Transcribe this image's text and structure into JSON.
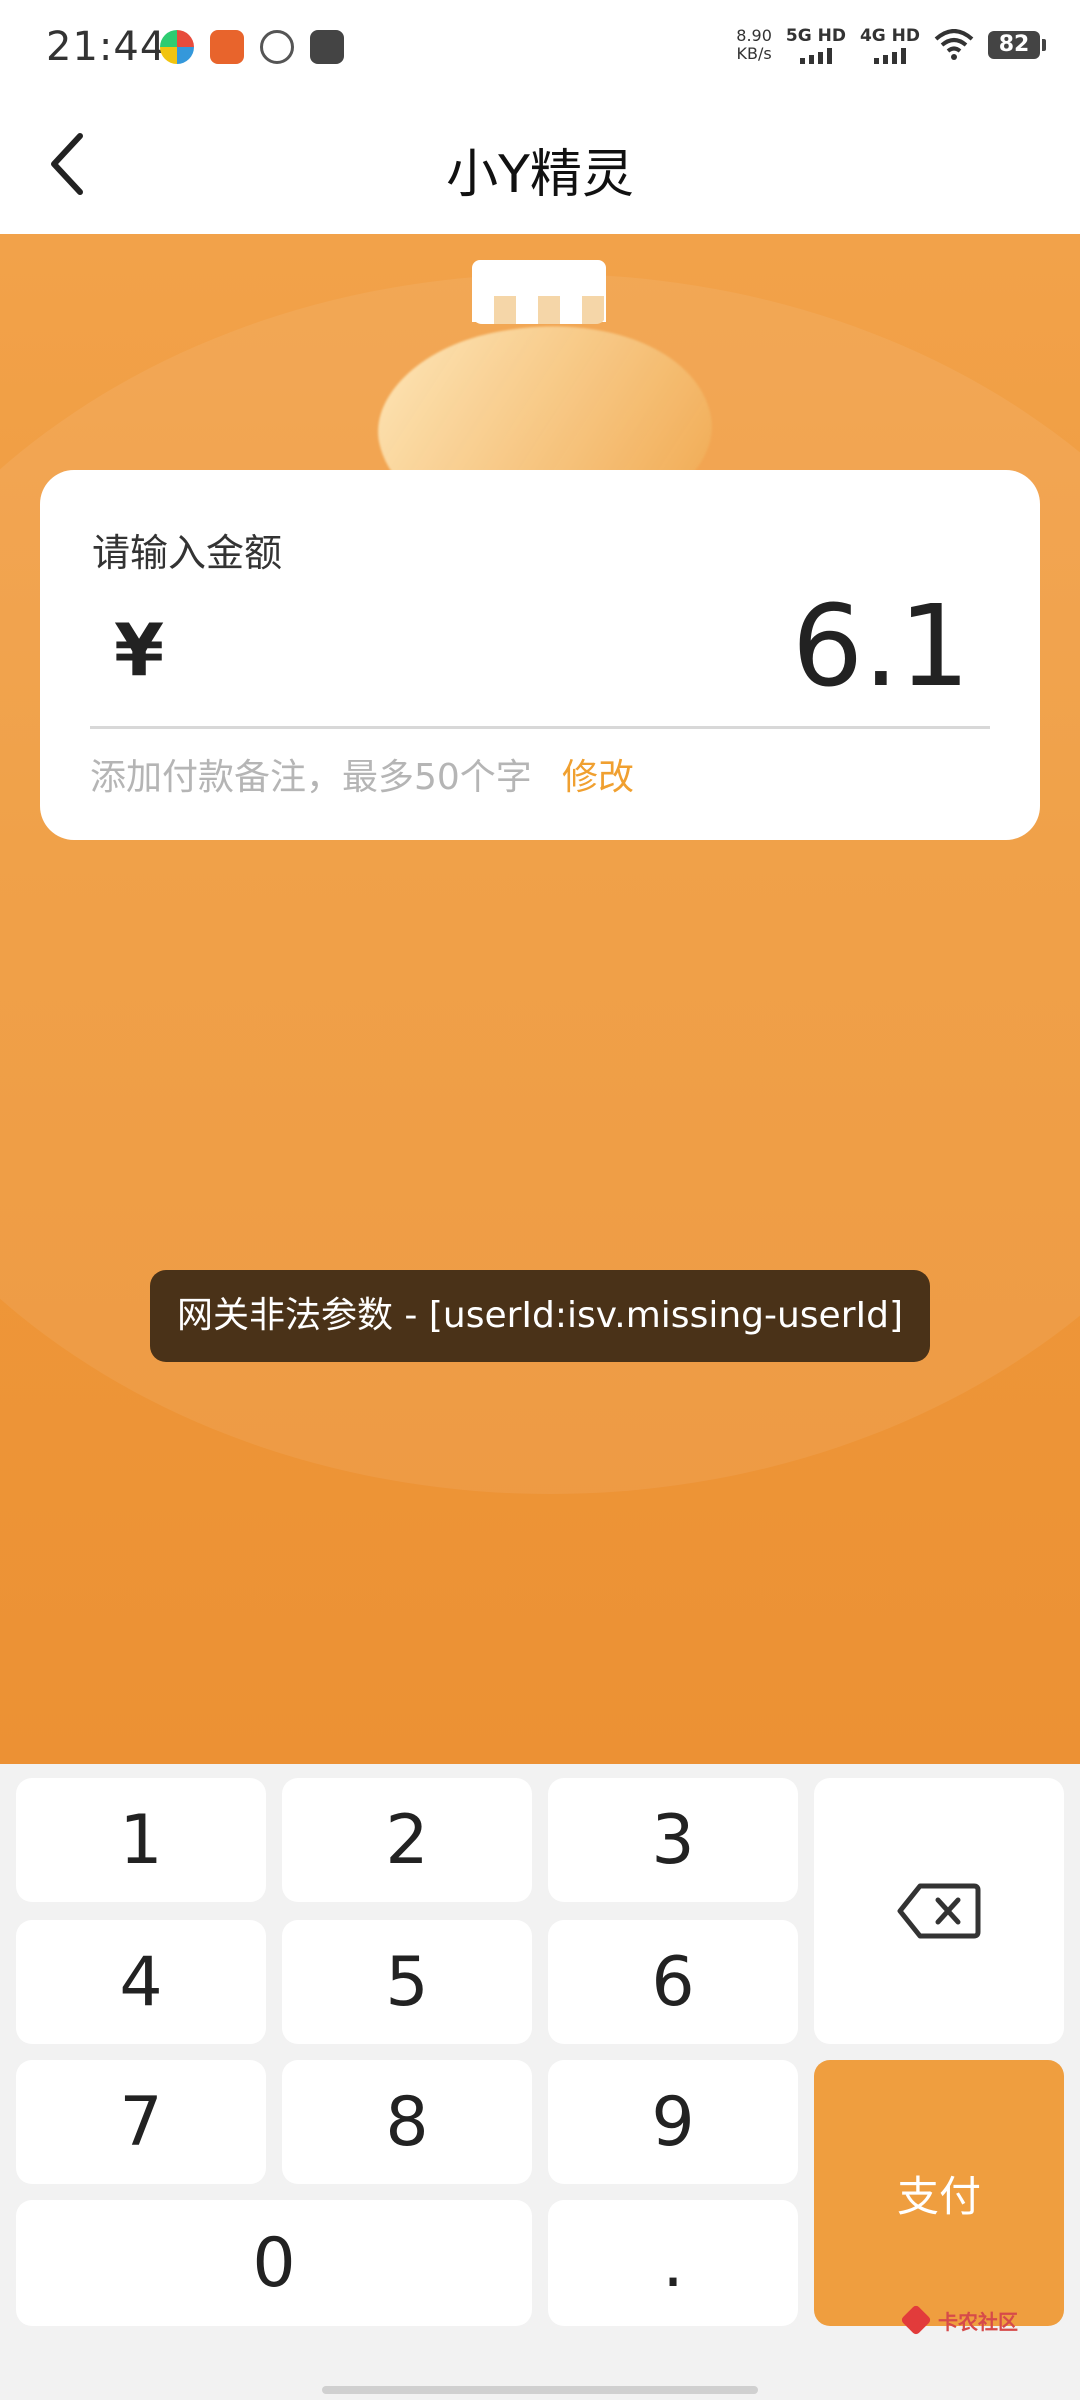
{
  "status": {
    "time": "21:44",
    "net_speed": "8.90",
    "net_speed_unit": "KB/s",
    "sim1": "5G HD",
    "sim2": "4G HD",
    "battery": "82"
  },
  "header": {
    "title": "小Y精灵"
  },
  "amount_card": {
    "label": "请输入金额",
    "currency": "¥",
    "value": "6.1",
    "remark_placeholder": "添加付款备注，最多50个字",
    "modify_label": "修改"
  },
  "toast": {
    "message": "网关非法参数 - [userId:isv.missing-userId]"
  },
  "keypad": {
    "k1": "1",
    "k2": "2",
    "k3": "3",
    "k4": "4",
    "k5": "5",
    "k6": "6",
    "k7": "7",
    "k8": "8",
    "k9": "9",
    "k0": "0",
    "dot": ".",
    "pay_label": "支付",
    "backspace_icon": "backspace-icon"
  },
  "watermark": {
    "text": "卡农社区"
  },
  "colors": {
    "accent": "#ef9e3f",
    "modify": "#f0a030",
    "toast_bg": "#4a3218"
  }
}
